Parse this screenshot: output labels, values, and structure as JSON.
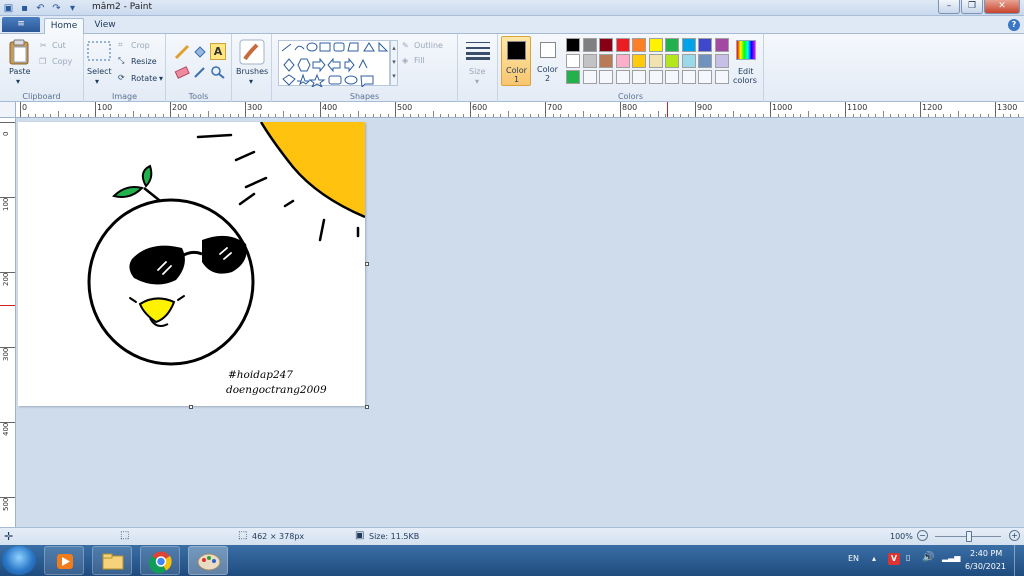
{
  "window": {
    "title": "mâm2 - Paint"
  },
  "tabs": {
    "file_label": "≡",
    "home": "Home",
    "view": "View"
  },
  "ribbon": {
    "clipboard": {
      "label": "Clipboard",
      "paste": "Paste",
      "cut": "Cut",
      "copy": "Copy"
    },
    "image": {
      "label": "Image",
      "select": "Select",
      "crop": "Crop",
      "resize": "Resize",
      "rotate": "Rotate"
    },
    "tools": {
      "label": "Tools"
    },
    "brushes": {
      "label": "Brushes"
    },
    "shapes": {
      "label": "Shapes",
      "outline": "Outline",
      "fill": "Fill"
    },
    "size": {
      "label": "Size"
    },
    "colors": {
      "label": "Colors",
      "color1": "Color\n1",
      "color1_label_a": "Color",
      "color1_label_b": "1",
      "color2_label_a": "Color",
      "color2_label_b": "2",
      "edit_label_a": "Edit",
      "edit_label_b": "colors",
      "color1_value": "#000000",
      "color2_value": "#ffffff",
      "palette_row1": [
        "#000000",
        "#7f7f7f",
        "#880015",
        "#ed1c24",
        "#ff7f27",
        "#fff200",
        "#22b14c",
        "#00a2e8",
        "#3f48cc",
        "#a349a4"
      ],
      "palette_row2": [
        "#ffffff",
        "#c3c3c3",
        "#b97a57",
        "#ffaec9",
        "#ffc90e",
        "#efe4b0",
        "#b5e61d",
        "#99d9ea",
        "#7092be",
        "#c8bfe7"
      ],
      "palette_row3": [
        "#22b14c",
        "",
        "",
        "",
        "",
        "",
        "",
        "",
        "",
        ""
      ]
    }
  },
  "ruler": {
    "h_ticks": [
      "0",
      "100",
      "200",
      "300",
      "400",
      "500",
      "600",
      "700",
      "800",
      "900",
      "1000",
      "1100",
      "1200",
      "1300"
    ],
    "v_ticks": [
      "0",
      "100",
      "200",
      "300",
      "400",
      "500"
    ]
  },
  "canvas_text": {
    "line1": "#hoidap247",
    "line2": "doengoctrang2009"
  },
  "status": {
    "dimensions": "462 × 378px",
    "size": "Size: 11.5KB",
    "zoom": "100%"
  },
  "taskbar": {
    "lang": "EN",
    "time": "2:40 PM",
    "date": "6/30/2021"
  }
}
